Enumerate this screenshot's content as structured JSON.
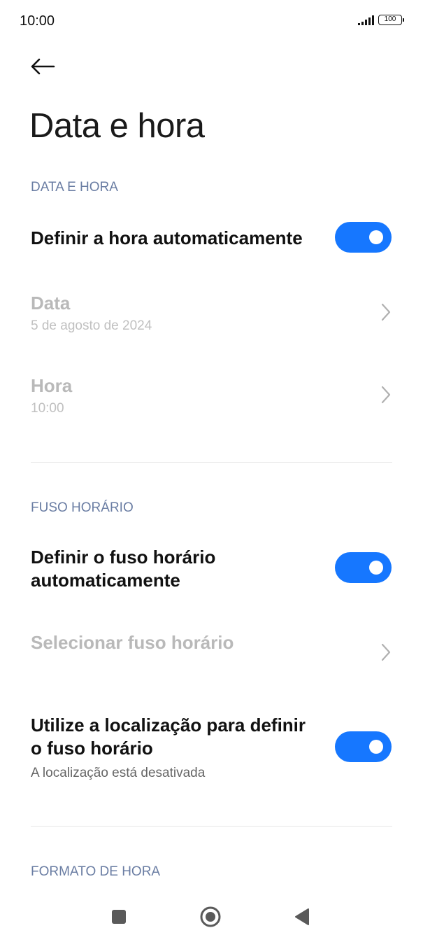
{
  "status_bar": {
    "time": "10:00",
    "battery": "100",
    "signal_icon": "signal-bars-icon"
  },
  "header": {
    "back_icon": "arrow-left-icon",
    "title": "Data e hora"
  },
  "sections": {
    "date_time": {
      "header": "DATA E HORA",
      "auto_time": {
        "label": "Definir a hora automaticamente",
        "enabled": true
      },
      "date": {
        "label": "Data",
        "value": "5 de agosto de 2024"
      },
      "time": {
        "label": "Hora",
        "value": "10:00"
      }
    },
    "timezone": {
      "header": "FUSO HORÁRIO",
      "auto_timezone": {
        "label_line1": "Definir o fuso horário",
        "label_line2": "automaticamente",
        "enabled": true
      },
      "select_timezone": {
        "label": "Selecionar fuso horário"
      },
      "use_location": {
        "label_line1": "Utilize a localização para definir",
        "label_line2": "o fuso horário",
        "subtitle": "A localização está desativada",
        "enabled": true
      }
    },
    "time_format": {
      "header": "FORMATO DE HORA"
    }
  },
  "colors": {
    "accent": "#1677ff",
    "section_header": "#6a7da3",
    "disabled_text": "#b9b9b9"
  },
  "nav_bar": {
    "recents_icon": "square-recents-icon",
    "home_icon": "circle-home-icon",
    "back_icon": "triangle-back-icon"
  }
}
